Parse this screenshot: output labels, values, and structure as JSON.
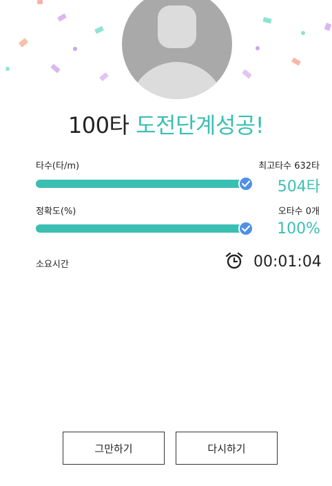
{
  "result": {
    "title_level": "100타",
    "title_message": "도전단계성공!"
  },
  "speed": {
    "label": "타수(타/m)",
    "best_label": "최고타수 632타",
    "value": "504타",
    "progress": 0.97
  },
  "accuracy": {
    "label": "정확도(%)",
    "typo_label": "오타수 0개",
    "value": "100%",
    "progress": 0.97
  },
  "elapsed": {
    "label": "소요시간",
    "value": "00:01:04",
    "icon": "alarm-clock-icon"
  },
  "buttons": {
    "quit": "그만하기",
    "retry": "다시하기"
  },
  "colors": {
    "accent": "#3bbfb3",
    "check": "#4f8fe8"
  }
}
